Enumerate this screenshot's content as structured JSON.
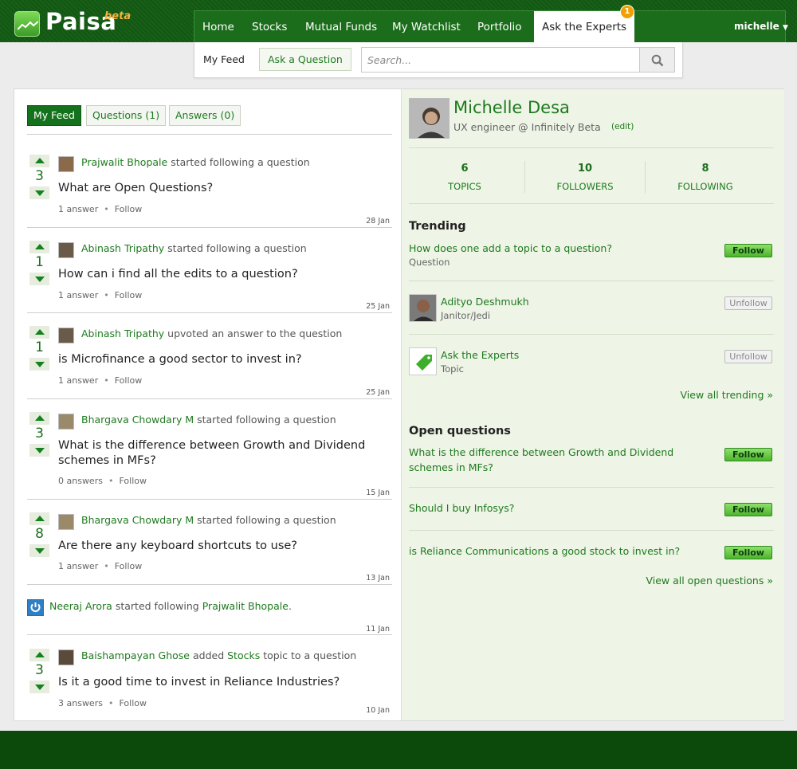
{
  "brand": {
    "name": "Paisa",
    "badge": "beta"
  },
  "nav": {
    "items": [
      {
        "label": "Home"
      },
      {
        "label": "Stocks"
      },
      {
        "label": "Mutual Funds"
      },
      {
        "label": "My Watchlist"
      },
      {
        "label": "Portfolio"
      },
      {
        "label": "Ask the Experts",
        "active": true
      }
    ],
    "notification_count": "1",
    "user": "michelle"
  },
  "subnav": {
    "feed_label": "My Feed",
    "ask_label": "Ask a Question",
    "search_placeholder": "Search..."
  },
  "tabs": [
    {
      "label": "My Feed",
      "active": true
    },
    {
      "label": "Questions (1)"
    },
    {
      "label": "Answers (0)"
    }
  ],
  "feed": [
    {
      "votes": "3",
      "user": "Prajwalit Bhopale",
      "action": "started following a question",
      "question": "What are Open Questions?",
      "answers": "1 answer",
      "follow": "Follow",
      "date": "28 Jan"
    },
    {
      "votes": "1",
      "user": "Abinash Tripathy",
      "action": "started following a question",
      "question": "How can i find all the edits to a question?",
      "answers": "1 answer",
      "follow": "Follow",
      "date": "25 Jan"
    },
    {
      "votes": "1",
      "user": "Abinash Tripathy",
      "action": "upvoted an answer to the question",
      "question": "is Microfinance a good sector to invest in?",
      "answers": "1 answer",
      "follow": "Follow",
      "date": "25 Jan"
    },
    {
      "votes": "3",
      "user": "Bhargava Chowdary M",
      "action": "started following a question",
      "question": "What is the difference between Growth and Dividend schemes in MFs?",
      "answers": "0 answers",
      "follow": "Follow",
      "date": "15 Jan"
    },
    {
      "votes": "8",
      "user": "Bhargava Chowdary M",
      "action": "started following a question",
      "question": "Are there any keyboard shortcuts to use?",
      "answers": "1 answer",
      "follow": "Follow",
      "date": "13 Jan"
    },
    {
      "user": "Neeraj Arora",
      "action": "started following",
      "target": "Prajwalit Bhopale",
      "trail": ".",
      "date": "11 Jan"
    },
    {
      "votes": "3",
      "user": "Baishampayan Ghose",
      "action_pre": "added",
      "topic": "Stocks",
      "action": "topic to a question",
      "question": "Is it a good time to invest in Reliance Industries?",
      "answers": "3 answers",
      "follow": "Follow",
      "date": "10 Jan"
    }
  ],
  "profile": {
    "name": "Michelle Desa",
    "title": "UX engineer @ Infinitely Beta",
    "edit": "(edit)",
    "stats": [
      {
        "num": "6",
        "label": "TOPICS"
      },
      {
        "num": "10",
        "label": "FOLLOWERS"
      },
      {
        "num": "8",
        "label": "FOLLOWING"
      }
    ]
  },
  "trending": {
    "heading": "Trending",
    "items": [
      {
        "title": "How does one add a topic to a question?",
        "sub": "Question",
        "button": "Follow"
      },
      {
        "title": "Adityo Deshmukh",
        "sub": "Janitor/Jedi",
        "button": "Unfollow"
      },
      {
        "title": "Ask the Experts",
        "sub": "Topic",
        "button": "Unfollow"
      }
    ],
    "view_all": "View all trending »"
  },
  "open_questions": {
    "heading": "Open questions",
    "items": [
      {
        "title": "What is the difference between Growth and Dividend schemes in MFs?",
        "button": "Follow"
      },
      {
        "title": "Should I buy Infosys?",
        "button": "Follow"
      },
      {
        "title": "is Reliance Communications a good stock to invest in?",
        "button": "Follow"
      }
    ],
    "view_all": "View all open questions »"
  },
  "colors": {
    "brand_green": "#125a12",
    "link_green": "#1e7a1e",
    "sidebar_bg": "#eef4e6",
    "follow_button": "#4cb52c",
    "notification": "#f0a000"
  }
}
